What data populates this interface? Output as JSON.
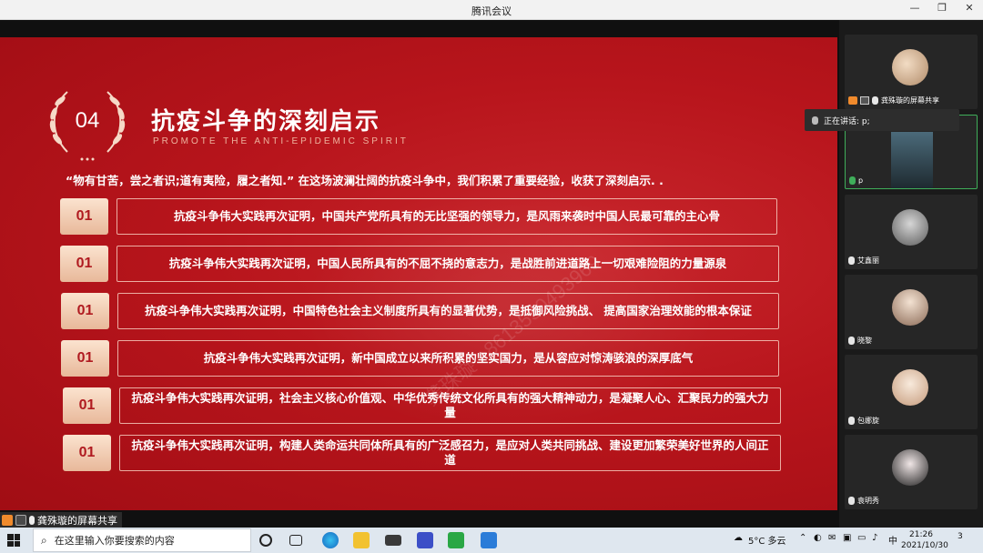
{
  "window": {
    "title": "腾讯会议",
    "controls": [
      "—",
      "❐",
      "✕"
    ]
  },
  "slide": {
    "badge_number": "04",
    "title": "抗疫斗争的深刻启示",
    "subtitle": "PROMOTE THE ANTI-EPIDEMIC SPIRIT",
    "quote": "“物有甘苦，尝之者识;道有夷险，履之者知.”  在这场波澜壮阔的抗疫斗争中，我们积累了重要经验，收获了深刻启示. .",
    "rows": [
      {
        "index": "01",
        "text": "抗疫斗争伟大实践再次证明，中国共产党所具有的无比坚强的领导力，是风雨来袭时中国人民最可靠的主心骨"
      },
      {
        "index": "01",
        "text": "抗疫斗争伟大实践再次证明，中国人民所具有的不屈不挠的意志力，是战胜前进道路上一切艰难险阻的力量源泉"
      },
      {
        "index": "01",
        "text": "抗疫斗争伟大实践再次证明，中国特色社会主义制度所具有的显著优势，是抵御风险挑战、 提高国家治理效能的根本保证"
      },
      {
        "index": "01",
        "text": "抗疫斗争伟大实践再次证明，新中国成立以来所积累的坚实国力，是从容应对惊涛骇浪的深厚底气"
      },
      {
        "index": "01",
        "text": "抗疫斗争伟大实践再次证明，社会主义核心价值观、中华优秀传统文化所具有的强大精神动力，是凝聚人心、汇聚民力的强大力量"
      },
      {
        "index": "01",
        "text": "抗疫斗争伟大实践再次证明，构建人类命运共同体所具有的广泛感召力，是应对人类共同挑战、建设更加繁荣美好世界的人间正道"
      }
    ],
    "watermark": "龚珠璇  +8613550493969"
  },
  "share_bar": {
    "label": "龚殊璇的屏幕共享"
  },
  "participants": [
    {
      "name": "龚殊璇的屏幕共享",
      "color": "#d8b79a"
    },
    {
      "name": "p",
      "color": "#3d5560"
    },
    {
      "name": "艾鑫丽",
      "color": "#7d7d7d"
    },
    {
      "name": "晓黎",
      "color": "#c9a98d"
    },
    {
      "name": "包娜旋",
      "color": "#e3c1a6"
    },
    {
      "name": "袁明秀",
      "color": "#2e2e2e"
    }
  ],
  "speaking": {
    "label": "正在讲话: p;"
  },
  "taskbar": {
    "search_placeholder": "在这里输入你要搜索的内容",
    "weather": "5°C  多云",
    "ime": "中",
    "time": "21:26",
    "date": "2021/10/30",
    "notification_count": "3"
  }
}
